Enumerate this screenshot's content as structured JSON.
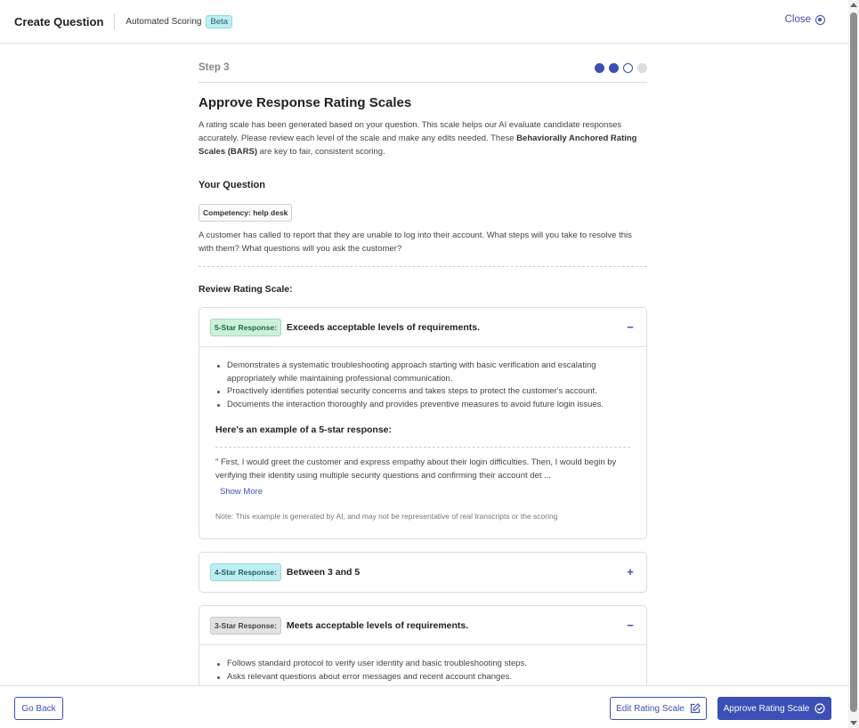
{
  "header": {
    "title": "Create Question",
    "subtitle": "Automated Scoring",
    "beta": "Beta",
    "close_label": "Close"
  },
  "step": {
    "label": "Step 3",
    "dots": [
      "done",
      "done",
      "current",
      "todo"
    ]
  },
  "main": {
    "title": "Approve Response Rating Scales",
    "intro_prefix": "A rating scale has been generated based on your question. This scale helps our AI evaluate candidate responses accurately. Please review each level of the scale and make any edits needed. These ",
    "intro_bold": "Behaviorally Anchored Rating Scales (BARS)",
    "intro_suffix": " are key to fair, consistent scoring.",
    "your_question_label": "Your Question",
    "competency": "Competency: help desk",
    "question_text": "A customer has called to report that they are unable to log into their account. What steps will you take to resolve this with them? What questions will you ask the customer?",
    "review_label": "Review Rating Scale:"
  },
  "cards": {
    "five": {
      "badge": "5-Star Response:",
      "title": "Exceeds acceptable levels of requirements.",
      "toggle": "−",
      "bullets": [
        "Demonstrates a systematic troubleshooting approach starting with basic verification and escalating appropriately while maintaining professional communication.",
        "Proactively identifies potential security concerns and takes steps to protect the customer's account.",
        "Documents the interaction thoroughly and provides preventive measures to avoid future login issues."
      ],
      "example_title": "Here's an example of a 5-star response:",
      "example_text": "\" First, I would greet the customer and express empathy about their login difficulties. Then, I would begin by verifying their identity using multiple security questions and confirming their account det ...",
      "show_more": "Show More",
      "note": "Note: This example is generated by AI, and may not be representative of real transcripts or the scoring"
    },
    "four": {
      "badge": "4-Star Response:",
      "title": "Between 3 and 5",
      "toggle": "+"
    },
    "three": {
      "badge": "3-Star Response:",
      "title": "Meets acceptable levels of requirements.",
      "toggle": "−",
      "bullets": [
        "Follows standard protocol to verify user identity and basic troubleshooting steps.",
        "Asks relevant questions about error messages and recent account changes."
      ]
    }
  },
  "footer": {
    "back_label": "Go Back",
    "edit_label": "Edit Rating Scale",
    "approve_label": "Approve Rating Scale"
  },
  "colors": {
    "accent": "#3b4fb5",
    "badge_green": "#cdf0dc",
    "badge_teal": "#bfeef2",
    "badge_gray": "#e2e2e2"
  }
}
